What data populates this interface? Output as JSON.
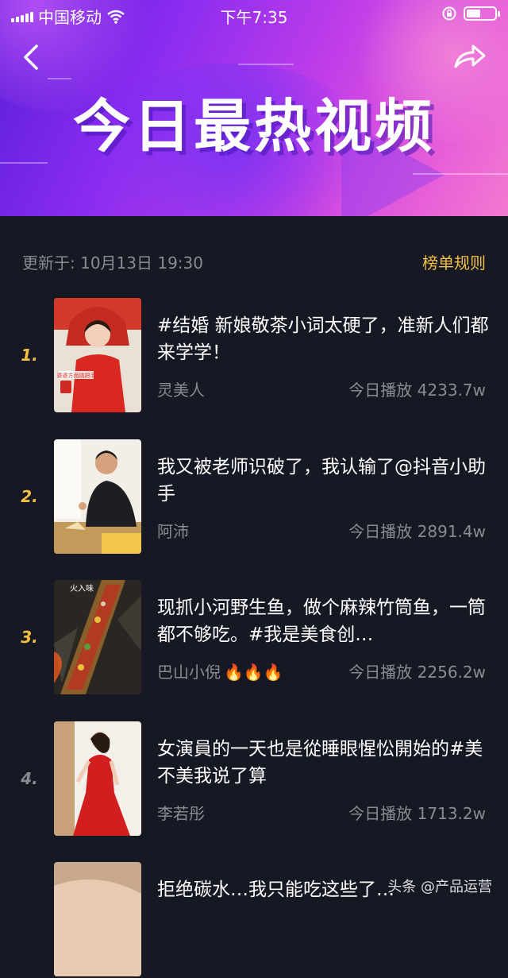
{
  "status_bar": {
    "carrier": "中国移动",
    "time": "下午7:35",
    "battery_level": 0.5
  },
  "header": {
    "title": "今日最热视频",
    "back_icon": "chevron-left-icon",
    "share_icon": "share-arrow-icon"
  },
  "list": {
    "updated_label": "更新于: 10月13日 19:30",
    "rules_label": "榜单规则",
    "items": [
      {
        "rank": "1.",
        "title": "#结婚 新娘敬茶小词太硬了，准新人们都来学学！",
        "author": "灵美人",
        "plays": "今日播放 4233.7w",
        "thumb_text": "婆婆方面挑把手"
      },
      {
        "rank": "2.",
        "title": "我又被老师识破了，我认输了@抖音小助手",
        "author": "阿沛",
        "plays": "今日播放 2891.4w"
      },
      {
        "rank": "3.",
        "title": "现抓小河野生鱼，做个麻辣竹筒鱼，一筒都不够吃。#我是美食创…",
        "author": "巴山小倪",
        "author_badge": "🔥🔥🔥",
        "plays": "今日播放 2256.2w",
        "thumb_text": "火入味"
      },
      {
        "rank": "4.",
        "title": "女演員的一天也是從睡眼惺忪開始的#美不美我说了算",
        "author": "李若彤",
        "plays": "今日播放 1713.2w"
      },
      {
        "rank": "",
        "title": "拒绝碳水…我只能吃这些了…",
        "author": "",
        "plays": ""
      }
    ]
  },
  "watermark": "头条 @产品运营",
  "colors": {
    "background": "#161823",
    "accent_gold": "#f4c043",
    "muted_text": "#8a8b93"
  }
}
